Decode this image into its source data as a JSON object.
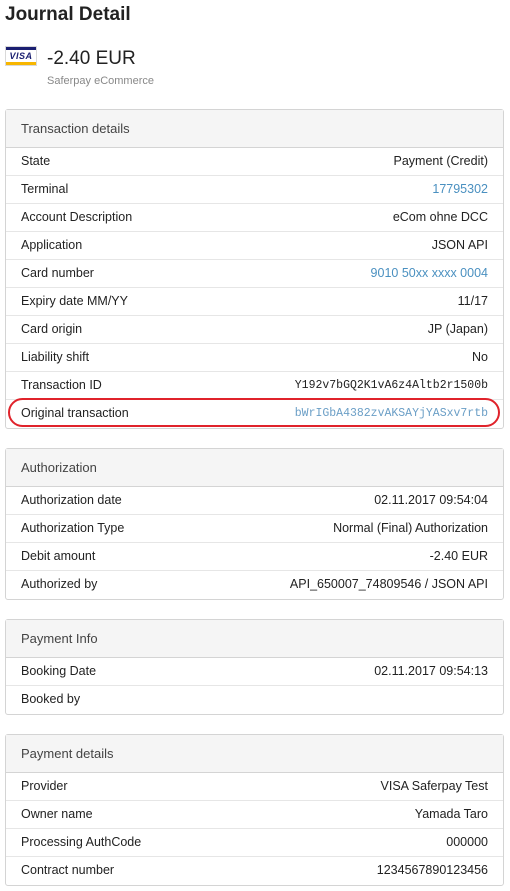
{
  "title": "Journal Detail",
  "header": {
    "card_brand": "VISA",
    "amount": "-2.40 EUR",
    "acquirer": "Saferpay eCommerce"
  },
  "colors": {
    "link": "#4a90c0",
    "highlight": "#e0232b",
    "panel_header_bg": "#f5f5f5"
  },
  "transaction": {
    "title": "Transaction details",
    "rows": [
      {
        "label": "State",
        "value": "Payment (Credit)"
      },
      {
        "label": "Terminal",
        "value": "17795302"
      },
      {
        "label": "Account Description",
        "value": "eCom ohne DCC"
      },
      {
        "label": "Application",
        "value": "JSON API"
      },
      {
        "label": "Card number",
        "value": "9010 50xx xxxx 0004"
      },
      {
        "label": "Expiry date MM/YY",
        "value": "11/17"
      },
      {
        "label": "Card origin",
        "value": "JP (Japan)"
      },
      {
        "label": "Liability shift",
        "value": "No"
      },
      {
        "label": "Transaction ID",
        "value": "Y192v7bGQ2K1vA6z4Altb2r1500b"
      },
      {
        "label": "Original transaction",
        "value": "bWrIGbA4382zvAKSAYjYASxv7rtb"
      }
    ]
  },
  "authorization": {
    "title": "Authorization",
    "rows": [
      {
        "label": "Authorization date",
        "value": "02.11.2017 09:54:04"
      },
      {
        "label": "Authorization Type",
        "value": "Normal (Final) Authorization"
      },
      {
        "label": "Debit amount",
        "value": "-2.40 EUR"
      },
      {
        "label": "Authorized by",
        "value": "API_650007_74809546 / JSON API"
      }
    ]
  },
  "payment_info": {
    "title": "Payment Info",
    "rows": [
      {
        "label": "Booking Date",
        "value": "02.11.2017 09:54:13"
      },
      {
        "label": "Booked by",
        "value": ""
      }
    ]
  },
  "payment_details": {
    "title": "Payment details",
    "rows": [
      {
        "label": "Provider",
        "value": "VISA Saferpay Test"
      },
      {
        "label": "Owner name",
        "value": "Yamada Taro"
      },
      {
        "label": "Processing AuthCode",
        "value": "000000"
      },
      {
        "label": "Contract number",
        "value": "1234567890123456"
      }
    ]
  }
}
